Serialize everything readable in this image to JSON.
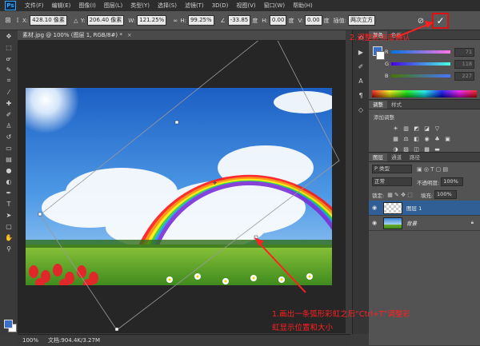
{
  "app": {
    "logo_text": "Ps"
  },
  "menubar": {
    "items": [
      "文件(F)",
      "编辑(E)",
      "图像(I)",
      "图层(L)",
      "类型(Y)",
      "选择(S)",
      "滤镜(T)",
      "3D(D)",
      "视图(V)",
      "窗口(W)",
      "帮助(H)"
    ]
  },
  "options": {
    "x_label": "X:",
    "x_value": "428.10 像素",
    "y_label": "Y:",
    "y_value": "206.40 像素",
    "w_label": "W:",
    "w_value": "121.25%",
    "h_label": "H:",
    "h_value": "99.25%",
    "angle_value": "-33.85",
    "angle_unit": "度",
    "hskew_label": "H:",
    "hskew_value": "0.00",
    "hskew_unit": "度",
    "vskew_label": "V:",
    "vskew_value": "0.00",
    "vskew_unit": "度",
    "interp_label": "插值:",
    "interp_value": "两次立方",
    "commit_symbol": "✓",
    "cancel_symbol": "⊘"
  },
  "document": {
    "tab_title": "素材.jpg @ 100% (图层 1, RGB/8#) *",
    "close_symbol": "×"
  },
  "status": {
    "zoom": "100%",
    "doc_info": "文档:904.4K/3.27M"
  },
  "color_panel": {
    "tabs": [
      "颜色",
      "色板"
    ],
    "r_label": "R",
    "g_label": "G",
    "b_label": "B",
    "r_value": "71",
    "g_value": "118",
    "b_value": "227"
  },
  "adjust_panel": {
    "tabs": [
      "调整",
      "样式"
    ],
    "title": "添加调整"
  },
  "layers_panel": {
    "tabs": [
      "图层",
      "通道",
      "路径"
    ],
    "kind_label": "P 类型",
    "blend_mode": "正常",
    "opacity_label": "不透明度:",
    "opacity_value": "100%",
    "lock_label": "锁定:",
    "fill_label": "填充:",
    "fill_value": "100%",
    "layers": [
      {
        "name": "图层 1"
      },
      {
        "name": "背景"
      }
    ]
  },
  "colors": {
    "annotation": "#ff2020",
    "foreground": "#3a6fc8"
  },
  "annotations": {
    "step1_line1": "1.画出一条弧形彩虹之后“Ctrl+T”调整彩",
    "step1_line2": "虹显示位置和大小",
    "step2": "2.调整好点击确认"
  }
}
